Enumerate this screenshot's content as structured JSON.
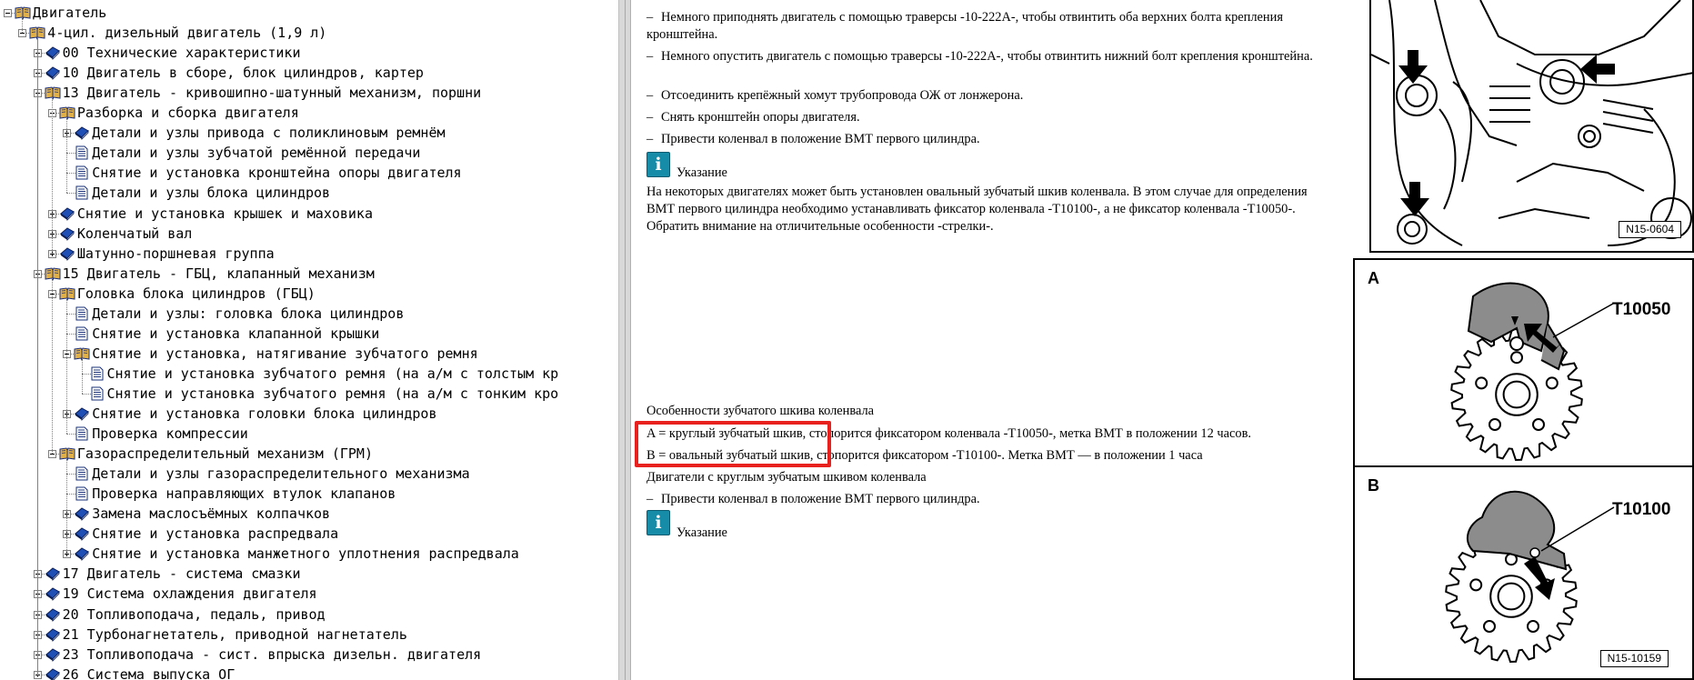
{
  "tree": [
    {
      "label": "Двигатель",
      "level": 0,
      "icon": "book-open-icon",
      "toggle": "minus"
    },
    {
      "label": "4-цил. дизельный двигатель (1,9 л)",
      "level": 1,
      "icon": "book-open-icon",
      "toggle": "minus"
    },
    {
      "label": "00 Технические характеристики",
      "level": 2,
      "icon": "book-closed-icon",
      "toggle": "plus"
    },
    {
      "label": "10 Двигатель в сборе, блок цилиндров, картер",
      "level": 2,
      "icon": "book-closed-icon",
      "toggle": "plus"
    },
    {
      "label": "13 Двигатель - кривошипно-шатунный механизм, поршни",
      "level": 2,
      "icon": "book-open-icon",
      "toggle": "minus"
    },
    {
      "label": "Разборка и сборка двигателя",
      "level": 3,
      "icon": "book-open-icon",
      "toggle": "minus"
    },
    {
      "label": "Детали и узлы привода с поликлиновым ремнём",
      "level": 4,
      "icon": "book-closed-icon",
      "toggle": "plus"
    },
    {
      "label": "Детали и узлы зубчатой ремённой передачи",
      "level": 4,
      "icon": "page-icon",
      "toggle": "none"
    },
    {
      "label": "Снятие и установка кронштейна опоры двигателя",
      "level": 4,
      "icon": "page-icon",
      "toggle": "none"
    },
    {
      "label": "Детали и узлы блока цилиндров",
      "level": 4,
      "icon": "page-icon",
      "toggle": "none"
    },
    {
      "label": "Снятие и установка крышек и маховика",
      "level": 3,
      "icon": "book-closed-icon",
      "toggle": "plus"
    },
    {
      "label": "Коленчатый вал",
      "level": 3,
      "icon": "book-closed-icon",
      "toggle": "plus"
    },
    {
      "label": "Шатунно-поршневая группа",
      "level": 3,
      "icon": "book-closed-icon",
      "toggle": "plus"
    },
    {
      "label": "15 Двигатель - ГБЦ, клапанный механизм",
      "level": 2,
      "icon": "book-open-icon",
      "toggle": "minus"
    },
    {
      "label": "Головка блока цилиндров (ГБЦ)",
      "level": 3,
      "icon": "book-open-icon",
      "toggle": "minus"
    },
    {
      "label": "Детали и узлы: головка блока цилиндров",
      "level": 4,
      "icon": "page-icon",
      "toggle": "none"
    },
    {
      "label": "Снятие и установка клапанной крышки",
      "level": 4,
      "icon": "page-icon",
      "toggle": "none"
    },
    {
      "label": "Снятие и установка, натягивание зубчатого ремня",
      "level": 4,
      "icon": "book-open-icon",
      "toggle": "minus"
    },
    {
      "label": "Снятие и установка зубчатого ремня (на а/м с толстым кр",
      "level": 5,
      "icon": "page-icon",
      "toggle": "none"
    },
    {
      "label": "Снятие и установка зубчатого ремня (на а/м с тонким кро",
      "level": 5,
      "icon": "page-icon",
      "toggle": "none"
    },
    {
      "label": "Снятие и установка головки блока цилиндров",
      "level": 4,
      "icon": "book-closed-icon",
      "toggle": "plus"
    },
    {
      "label": "Проверка компрессии",
      "level": 4,
      "icon": "page-icon",
      "toggle": "none"
    },
    {
      "label": "Газораспределительный механизм (ГРМ)",
      "level": 3,
      "icon": "book-open-icon",
      "toggle": "minus"
    },
    {
      "label": "Детали и узлы газораспределительного механизма",
      "level": 4,
      "icon": "page-icon",
      "toggle": "none"
    },
    {
      "label": "Проверка направляющих втулок клапанов",
      "level": 4,
      "icon": "page-icon",
      "toggle": "none"
    },
    {
      "label": "Замена маслосъёмных колпачков",
      "level": 4,
      "icon": "book-closed-icon",
      "toggle": "plus"
    },
    {
      "label": "Снятие и установка распредвала",
      "level": 4,
      "icon": "book-closed-icon",
      "toggle": "plus"
    },
    {
      "label": "Снятие и установка манжетного уплотнения распредвала",
      "level": 4,
      "icon": "book-closed-icon",
      "toggle": "plus"
    },
    {
      "label": "17 Двигатель - система смазки",
      "level": 2,
      "icon": "book-closed-icon",
      "toggle": "plus"
    },
    {
      "label": "19 Система охлаждения двигателя",
      "level": 2,
      "icon": "book-closed-icon",
      "toggle": "plus"
    },
    {
      "label": "20 Топливоподача, педаль, привод",
      "level": 2,
      "icon": "book-closed-icon",
      "toggle": "plus"
    },
    {
      "label": "21 Турбонагнетатель, приводной нагнетатель",
      "level": 2,
      "icon": "book-closed-icon",
      "toggle": "plus"
    },
    {
      "label": "23 Топливоподача - сист. впрыска дизельн. двигателя",
      "level": 2,
      "icon": "book-closed-icon",
      "toggle": "plus"
    },
    {
      "label": "26 Система выпуска ОГ",
      "level": 2,
      "icon": "book-closed-icon",
      "toggle": "plus"
    }
  ],
  "content": {
    "steps_top": [
      "Немного приподнять двигатель с помощью траверсы -10-222A-, чтобы отвинтить оба верхних болта крепления кронштейна.",
      "Немного опустить двигатель с помощью траверсы -10-222A-, чтобы отвинтить нижний болт крепления кронштейна.",
      "Отсоединить крепёжный хомут трубопровода ОЖ от лонжерона.",
      "Снять кронштейн опоры двигателя.",
      "Привести коленвал в положение ВМТ первого цилиндра."
    ],
    "note1_title": "Указание",
    "note1_text": "На некоторых двигателях может быть установлен овальный зубчатый шкив коленвала. В этом случае для определения ВМТ первого цилиндра необходимо устанавливать фиксатор коленвала -T10100-, а не фиксатор коленвала -T10050-. Обратить внимание на отличительные особенности -стрелки-.",
    "features_title": "Особенности зубчатого шкива коленвала",
    "feature_a": "A = круглый зубчатый шкив, стопорится фиксатором коленвала -T10050-, метка ВМТ в положении 12 часов.",
    "feature_b": "B = овальный зубчатый шкив, стопорится фиксатором -T10100-. Метка ВМТ — в положении 1 часа",
    "round_title": "Двигатели с круглым зубчатым шкивом коленвала",
    "step_round": "Привести коленвал в положение ВМТ первого цилиндра.",
    "note2_title": "Указание",
    "info_glyph": "i",
    "dash": "–"
  },
  "figures": {
    "top_ref": "N15-0604",
    "a_label": "A",
    "a_tool": "T10050",
    "b_label": "B",
    "b_tool": "T10100",
    "bottom_ref": "N15-10159"
  },
  "colors": {
    "highlight": "#e8201e",
    "info_icon": "#168ca8",
    "book_blue": "#1f4fb4",
    "book_open": "#e0b04a"
  }
}
